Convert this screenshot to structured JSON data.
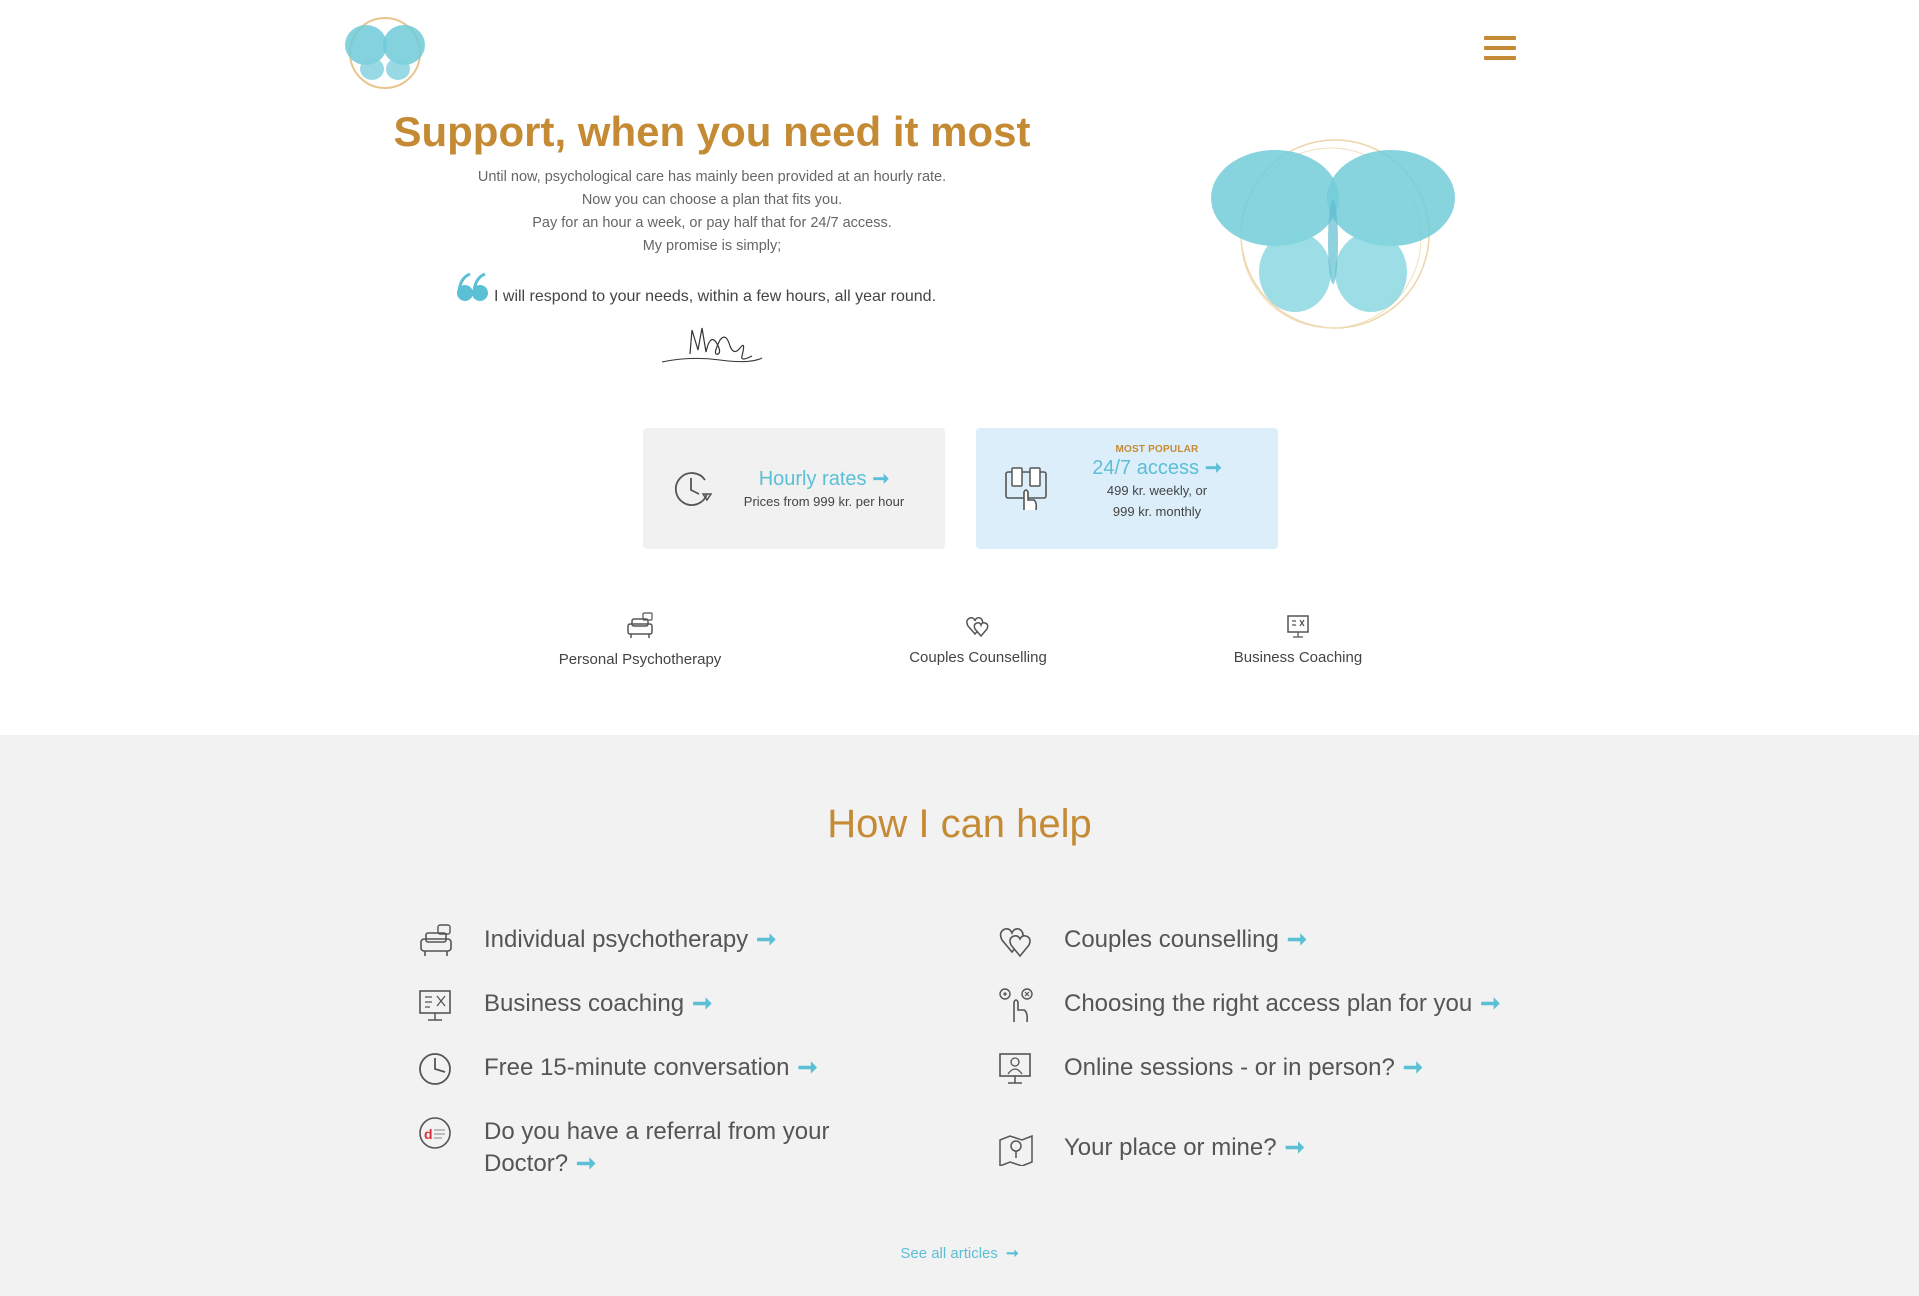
{
  "header": {
    "logo_alt": "butterfly-logo",
    "menu_icon": "hamburger-menu-icon"
  },
  "hero": {
    "title": "Support, when you need it most",
    "lines": [
      "Until now, psychological care has mainly been provided at an hourly rate.",
      "Now you can choose a plan that fits you.",
      "Pay for an hour a week, or pay half that for 24/7 access.",
      "My promise is simply;"
    ],
    "quote": "I will respond to your needs, within a few hours, all year round."
  },
  "cards": {
    "hourly": {
      "title": "Hourly rates",
      "arrow": "➞",
      "subtitle": "Prices from 999 kr. per hour"
    },
    "access": {
      "badge": "MOST POPULAR",
      "title": "24/7 access",
      "arrow": "➞",
      "line1": "499 kr. weekly, or",
      "line2": "999 kr. monthly"
    }
  },
  "services": [
    {
      "label": "Personal Psychotherapy",
      "icon": "couch-icon"
    },
    {
      "label": "Couples Counselling",
      "icon": "hearts-icon"
    },
    {
      "label": "Business Coaching",
      "icon": "presentation-board-icon"
    }
  ],
  "help": {
    "title": "How I can help",
    "left": [
      {
        "text": "Individual psychotherapy",
        "icon": "couch-icon"
      },
      {
        "text": "Business coaching",
        "icon": "presentation-board-icon"
      },
      {
        "text": "Free 15-minute conversation",
        "icon": "clock-icon"
      },
      {
        "text_line1": "Do you have a referral from your",
        "text_line2": "Doctor?",
        "icon": "referral-icon"
      }
    ],
    "right": [
      {
        "text": "Couples counselling",
        "icon": "hearts-icon"
      },
      {
        "text": "Choosing the right access plan for you",
        "icon": "hand-choice-icon"
      },
      {
        "text": "Online sessions - or in person?",
        "icon": "monitor-icon"
      },
      {
        "text": "Your place or mine?",
        "icon": "map-pin-icon"
      }
    ],
    "arrow": "➞",
    "see_all": "See all articles",
    "see_all_arrow": "➞"
  },
  "colors": {
    "accent_gold": "#c58b34",
    "accent_blue": "#5bbfd6",
    "card_gray": "#f1f1f1",
    "card_blue": "#dbeef9",
    "section_gray": "#f2f2f2"
  }
}
